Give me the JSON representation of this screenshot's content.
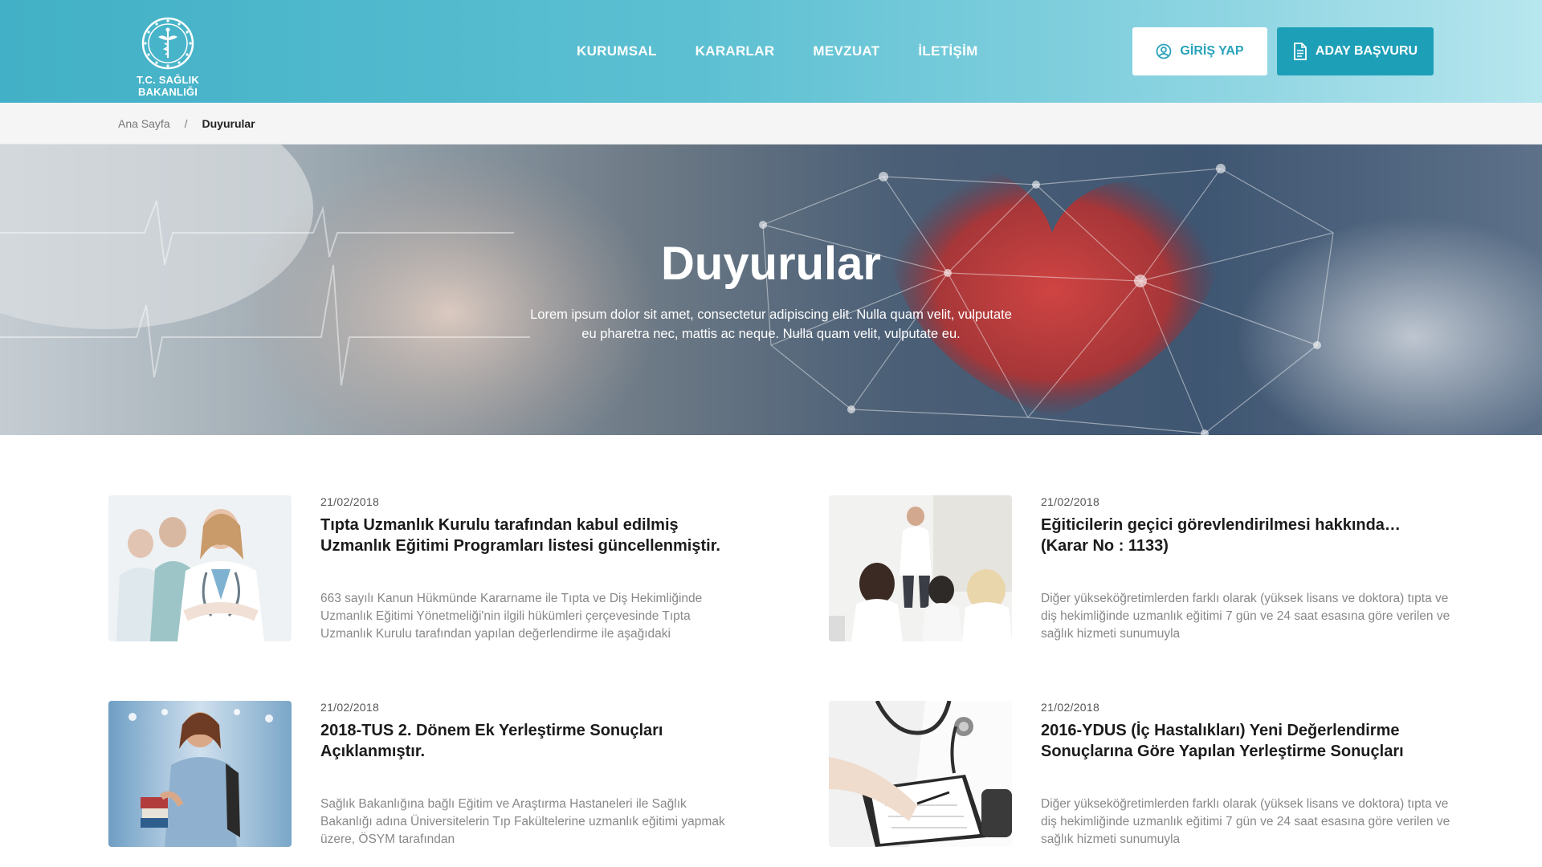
{
  "header": {
    "logo_text": "T.C. SAĞLIK BAKANLIĞI",
    "nav": [
      "KURUMSAL",
      "KARARLAR",
      "MEVZUAT",
      "İLETİŞİM"
    ],
    "login_label": "GİRİŞ YAP",
    "apply_label": "ADAY BAŞVURU"
  },
  "breadcrumb": {
    "home": "Ana Sayfa",
    "separator": "/",
    "current": "Duyurular"
  },
  "hero": {
    "title": "Duyurular",
    "description": "Lorem ipsum dolor sit amet, consectetur adipiscing elit. Nulla quam velit, vulputate eu pharetra nec, mattis ac neque. Nulla quam velit, vulputate eu."
  },
  "announcements": [
    {
      "date": "21/02/2018",
      "title": "Tıpta Uzmanlık Kurulu tarafından kabul edilmiş Uzmanlık Eğitimi Programları listesi güncellenmiştir.",
      "excerpt": "663 sayılı Kanun Hükmünde Kararname ile Tıpta ve Diş Hekimliğinde Uzmanlık Eğitimi Yönetmeliği'nin ilgili hükümleri çerçevesinde Tıpta Uzmanlık Kurulu tarafından yapılan değerlendirme ile aşağıdaki"
    },
    {
      "date": "21/02/2018",
      "title": "Eğiticilerin geçici görevlendirilmesi hakkında… (Karar No : 1133)",
      "excerpt": "Diğer yükseköğretimlerden farklı olarak (yüksek lisans ve doktora) tıpta ve diş hekimliğinde uzmanlık eğitimi 7 gün ve 24 saat esasına göre verilen ve sağlık hizmeti sunumuyla"
    },
    {
      "date": "21/02/2018",
      "title": "2018-TUS 2. Dönem Ek Yerleştirme Sonuçları Açıklanmıştır.",
      "excerpt": "Sağlık Bakanlığına bağlı Eğitim ve Araştırma Hastaneleri ile Sağlık Bakanlığı adına Üniversitelerin Tıp Fakültelerine uzmanlık eğitimi yapmak üzere, ÖSYM tarafından"
    },
    {
      "date": "21/02/2018",
      "title": "2016-YDUS (İç Hastalıkları) Yeni Değerlendirme Sonuçlarına Göre Yapılan Yerleştirme Sonuçları",
      "excerpt": "Diğer yükseköğretimlerden farklı olarak (yüksek lisans ve doktora) tıpta ve diş hekimliğinde uzmanlık eğitimi 7 gün ve 24 saat esasına göre verilen ve sağlık hizmeti sunumuyla"
    }
  ]
}
